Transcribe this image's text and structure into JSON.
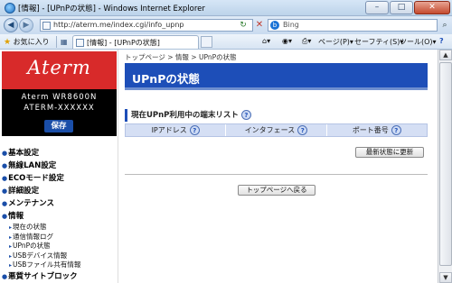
{
  "window": {
    "title": "[情報] - [UPnPの状態] - Windows Internet Explorer",
    "minimize": "–",
    "maximize": "□",
    "close": "✕"
  },
  "addressbar": {
    "url": "http://aterm.me/index.cgi/info_upnp",
    "search_placeholder": "Bing"
  },
  "favbar": {
    "favorites_label": "お気に入り",
    "tab_label": "[情報] - [UPnPの状態]",
    "page_menu": "ページ(P)",
    "safety_menu": "セーフティ(S)",
    "tools_menu": "ツール(O)",
    "help_menu": "?"
  },
  "sidebar": {
    "logo_text": "Aterm",
    "model_line1": "Aterm WR8600N",
    "model_line2": "ATERM-XXXXXX",
    "save_button": "保存",
    "menu": [
      {
        "label": "基本設定"
      },
      {
        "label": "無線LAN設定"
      },
      {
        "label": "ECOモード設定"
      },
      {
        "label": "詳細設定"
      },
      {
        "label": "メンテナンス"
      },
      {
        "label": "情報"
      }
    ],
    "submenu": [
      {
        "label": "現在の状態"
      },
      {
        "label": "通信情報ログ"
      },
      {
        "label": "UPnPの状態"
      },
      {
        "label": "USBデバイス情報"
      },
      {
        "label": "USBファイル共有情報"
      }
    ],
    "bottom_item": "悪質サイトブロック"
  },
  "main": {
    "breadcrumb": "トップページ > 情報 > UPnPの状態",
    "header": "UPnPの状態",
    "section_title": "現在UPnP利用中の端末リスト",
    "columns": [
      "IPアドレス",
      "インタフェース",
      "ポート番号"
    ],
    "refresh_button": "最新状態に更新",
    "back_button": "トップページへ戻る",
    "help_mark": "?"
  },
  "colors": {
    "brand_red": "#d82a2a",
    "header_blue": "#1d4eb8",
    "table_header_bg": "#d5dff4"
  }
}
